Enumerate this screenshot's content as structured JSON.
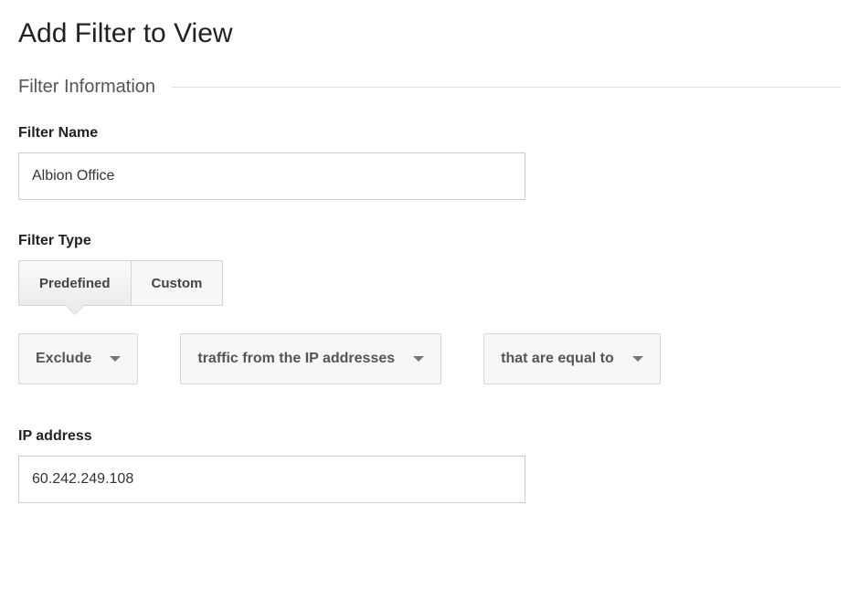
{
  "page_title": "Add Filter to View",
  "section_heading": "Filter Information",
  "filter_name": {
    "label": "Filter Name",
    "value": "Albion Office"
  },
  "filter_type": {
    "label": "Filter Type",
    "tabs": {
      "predefined": "Predefined",
      "custom": "Custom"
    },
    "dropdowns": {
      "action": "Exclude",
      "source": "traffic from the IP addresses",
      "match": "that are equal to"
    }
  },
  "ip_address": {
    "label": "IP address",
    "value": "60.242.249.108"
  }
}
